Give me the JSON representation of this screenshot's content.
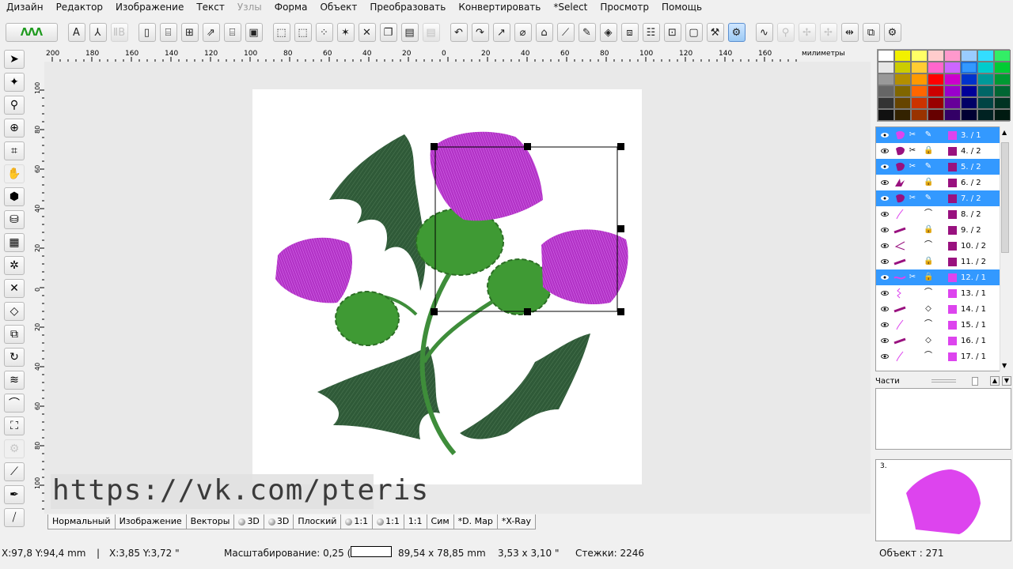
{
  "menu": [
    "Дизайн",
    "Редактор",
    "Изображение",
    "Текст",
    "Узлы",
    "Форма",
    "Объект",
    "Преобразовать",
    "Конвертировать",
    "*Select",
    "Просмотр",
    "Помощь"
  ],
  "menu_disabled_index": 4,
  "toolbar_icons": [
    "stitch-preview-icon",
    "text-a-icon",
    "monogram-icon",
    "letters-disabled-icon",
    "new-file-icon",
    "open-icon",
    "import-icon",
    "export-icon",
    "open-folder-icon",
    "save-icon",
    "select-rect-icon",
    "select-dotted-icon",
    "select-lasso-icon",
    "select-magic-icon",
    "cut-icon",
    "copy-icon",
    "paste-icon",
    "paste-disabled-icon",
    "undo-icon",
    "redo-icon",
    "reshape-icon",
    "eraser-icon",
    "envelope-icon",
    "eyedropper-icon",
    "edit-icon",
    "fill-icon",
    "gradient-icon",
    "stitch-list-icon",
    "zoom-fit-icon",
    "frame-icon",
    "tools-icon",
    "active-tool-icon",
    "curve-icon",
    "disabled-a-icon",
    "disabled-b-icon",
    "disabled-c-icon",
    "mirror-icon",
    "layers-icon",
    "settings-icon"
  ],
  "left_tools": [
    "pointer-icon",
    "node-edit-icon",
    "zoom-icon",
    "zoom-in-icon",
    "crop-icon",
    "pan-hand-icon",
    "shape-icon",
    "stamp-icon",
    "fill-blocks-icon",
    "star-icon",
    "satin-icon",
    "running-icon",
    "column-icon",
    "spiral-icon",
    "zigzag-icon",
    "bezier-icon",
    "outline-icon",
    "gear-icon",
    "needle-icon",
    "pen-icon",
    "knife-icon"
  ],
  "ruler": {
    "h_labels": [
      "200",
      "180",
      "160",
      "140",
      "120",
      "100",
      "80",
      "60",
      "40",
      "20",
      "0",
      "20",
      "40",
      "60",
      "80",
      "100",
      "120",
      "140",
      "160"
    ],
    "unit": "милиметры",
    "v_labels": [
      "100",
      "80",
      "60",
      "40",
      "20",
      "0",
      "20",
      "40",
      "60",
      "80",
      "100"
    ]
  },
  "watermark": "https://vk.com/pteris",
  "view_tabs": [
    "Нормальный",
    "Изображение",
    "Векторы",
    "3D",
    "3D",
    "Плоский",
    "1:1",
    "1:1",
    "1:1",
    "Сим",
    "*D. Мар",
    "*X-Ray"
  ],
  "status": {
    "cursor_mm": "X:97,8  Y:94,4 mm",
    "cursor_in": "X:3,85  Y:3,72 \"",
    "zoom": "Масштабирование: 0,25 (8",
    "size_mm": "89,54 x 78,85 mm",
    "size_in": "3,53 x 3,10 \"",
    "stitches": "Стежки:  2246",
    "object": "Объект : 271"
  },
  "palette": [
    "#ffffff",
    "#f2f000",
    "#ffff66",
    "#ffcccc",
    "#ff99cc",
    "#99ccff",
    "#33ddff",
    "#33ee66",
    "#e6e6e6",
    "#cccc00",
    "#ffcc33",
    "#ff66cc",
    "#cc66ff",
    "#3399ff",
    "#00cccc",
    "#00cc33",
    "#999999",
    "#b38f00",
    "#ff9900",
    "#ff0000",
    "#cc00cc",
    "#0033cc",
    "#009999",
    "#009933",
    "#666666",
    "#806600",
    "#ff6600",
    "#cc0000",
    "#9900cc",
    "#000099",
    "#006666",
    "#006633",
    "#333333",
    "#664400",
    "#cc3300",
    "#990000",
    "#660099",
    "#000066",
    "#004444",
    "#003322",
    "#111111",
    "#332200",
    "#993300",
    "#660000",
    "#330066",
    "#000033",
    "#002222",
    "#001a11"
  ],
  "palette_selected": 13,
  "layers": [
    {
      "label": "3. / 1",
      "color": "#dd44ee",
      "sel": true,
      "thumb": "blob",
      "ic1": "✂",
      "ic2": "✎"
    },
    {
      "label": "4. / 2",
      "color": "#99117f",
      "sel": false,
      "thumb": "blob-dark",
      "ic1": "✂",
      "ic2": "🔒"
    },
    {
      "label": "5. / 2",
      "color": "#99117f",
      "sel": true,
      "thumb": "blob-dark",
      "ic1": "✂",
      "ic2": "✎"
    },
    {
      "label": "6. / 2",
      "color": "#99117f",
      "sel": false,
      "thumb": "claw",
      "ic1": "",
      "ic2": "🔒"
    },
    {
      "label": "7. / 2",
      "color": "#99117f",
      "sel": true,
      "thumb": "blob-dark",
      "ic1": "✂",
      "ic2": "✎"
    },
    {
      "label": "8. / 2",
      "color": "#99117f",
      "sel": false,
      "thumb": "line",
      "ic1": "",
      "ic2": "⌒"
    },
    {
      "label": "9. / 2",
      "color": "#99117f",
      "sel": false,
      "thumb": "stroke",
      "ic1": "",
      "ic2": "🔒"
    },
    {
      "label": "10. / 2",
      "color": "#99117f",
      "sel": false,
      "thumb": "angle",
      "ic1": "",
      "ic2": "⌒"
    },
    {
      "label": "11. / 2",
      "color": "#99117f",
      "sel": false,
      "thumb": "stroke",
      "ic1": "",
      "ic2": "🔒"
    },
    {
      "label": "12. / 1",
      "color": "#dd44ee",
      "sel": true,
      "thumb": "wave",
      "ic1": "✂",
      "ic2": "🔒"
    },
    {
      "label": "13. / 1",
      "color": "#dd44ee",
      "sel": false,
      "thumb": "zig",
      "ic1": "",
      "ic2": "⌒"
    },
    {
      "label": "14. / 1",
      "color": "#dd44ee",
      "sel": false,
      "thumb": "stroke",
      "ic1": "",
      "ic2": "◇"
    },
    {
      "label": "15. / 1",
      "color": "#dd44ee",
      "sel": false,
      "thumb": "line",
      "ic1": "",
      "ic2": "⌒"
    },
    {
      "label": "16. / 1",
      "color": "#dd44ee",
      "sel": false,
      "thumb": "stroke",
      "ic1": "",
      "ic2": "◇"
    },
    {
      "label": "17. / 1",
      "color": "#dd44ee",
      "sel": false,
      "thumb": "line",
      "ic1": "",
      "ic2": "⌒"
    }
  ],
  "parts_label": "Части",
  "preview_label": "3."
}
